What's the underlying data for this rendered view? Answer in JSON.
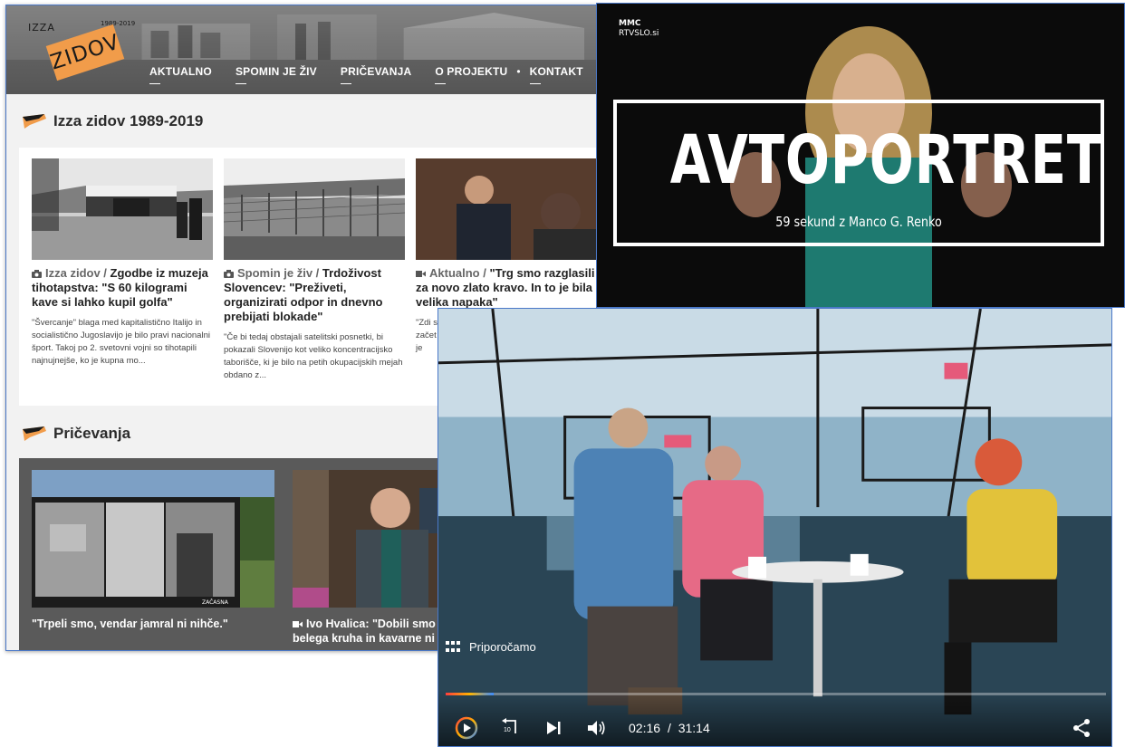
{
  "site": {
    "logo_top": "IZZA",
    "logo_main": "ZIDOV",
    "logo_years": "1989-2019",
    "nav": [
      "AKTUALNO",
      "SPOMIN JE ŽIV",
      "PRIČEVANJA",
      "O PROJEKTU",
      "KONTAKT"
    ],
    "nav_separator": "•",
    "section1_title": "Izza zidov 1989-2019",
    "cards": [
      {
        "icon": "camera-icon",
        "kicker": "Izza zidov /",
        "title": "Zgodbe iz muzeja tihotapstva: \"S 60 kilogrami kave si lahko kupil golfa\"",
        "excerpt": "\"Švercanje\" blaga med kapitalistično Italijo in socialistično Jugoslavijo je bilo pravi nacionalni šport. Takoj po 2. svetovni vojni so tihotapili najnujnejše, ko je kupna mo..."
      },
      {
        "icon": "camera-icon",
        "kicker": "Spomin je živ /",
        "title": "Trdoživost Slovencev: \"Preživeti, organizirati odpor in dnevno prebijati blokade\"",
        "excerpt": "\"Če bi tedaj obstajali satelitski posnetki, bi pokazali Slovenijo kot veliko koncentracijsko taborišče, ki je bilo na petih okupacijskih mejah obdano z..."
      },
      {
        "icon": "video-icon",
        "kicker": "Aktualno /",
        "title": "\"Trg smo razglasili za novo zlato kravo. In to je bila velika napaka\"",
        "excerpt": "\"Zdi svob začet kot je"
      }
    ],
    "section2_title": "Pričevanja",
    "pricevanja": [
      {
        "icon": "",
        "caption": "\"Trpeli smo, vendar jamral ni nihče.\""
      },
      {
        "icon": "video-icon",
        "caption": "Ivo Hvalica: \"Dobili smo",
        "caption2": "belega kruha in kavarne ni"
      }
    ],
    "photo_text": "ZAČASNA"
  },
  "rtv": {
    "logo_line1": "MMC",
    "logo_line2": "RTVSLO.si",
    "title": "AVTOPORTRET",
    "subtitle": "59 sekund z Manco G. Renko",
    "below_text": "...."
  },
  "player": {
    "recommended_label": "Priporočamo",
    "current_time": "02:16",
    "separator": "/",
    "duration": "31:14",
    "progress_fraction": 0.073,
    "skip_seconds": "10"
  },
  "colors": {
    "accent_orange": "#f19c4a",
    "link_blue_border": "#4a78c8"
  }
}
